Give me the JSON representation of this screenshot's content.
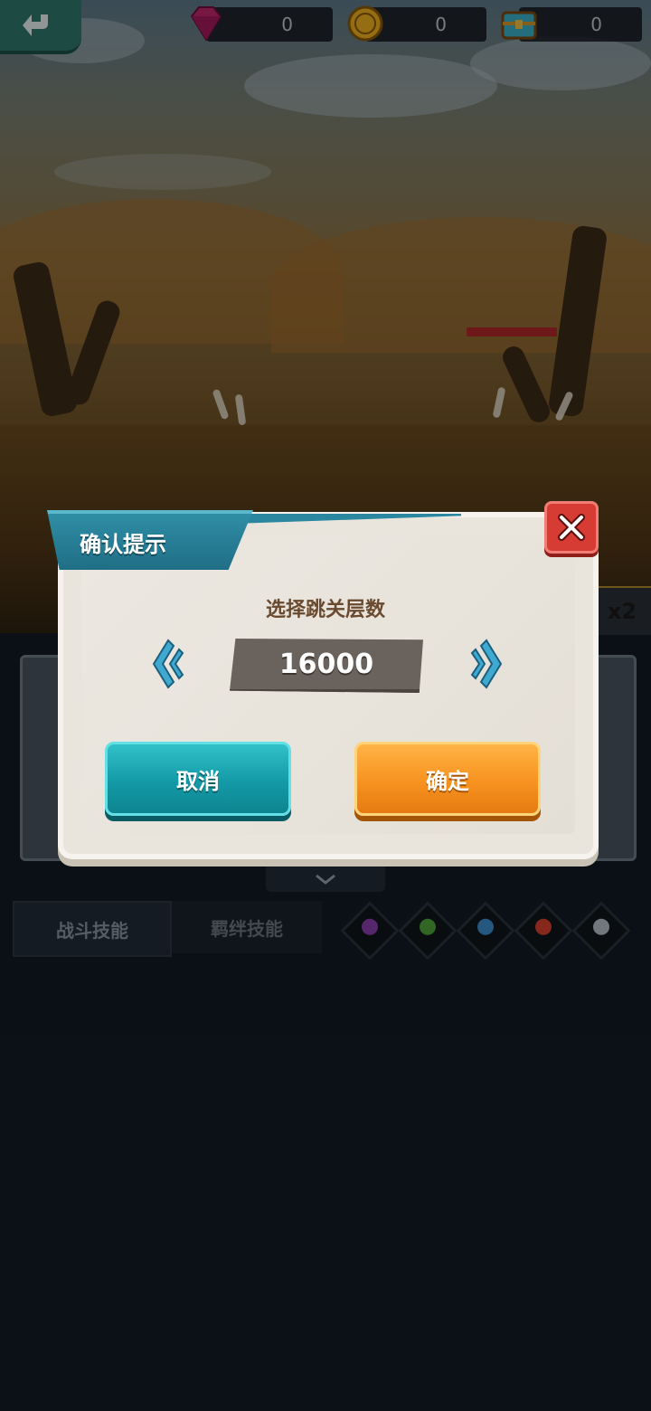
{
  "resources": [
    {
      "name": "gem",
      "value": "0",
      "icon": "gem-icon",
      "color": "#c2266e"
    },
    {
      "name": "coin",
      "value": "0",
      "icon": "coin-icon",
      "color": "#f0b020"
    },
    {
      "name": "chest",
      "value": "0",
      "icon": "treasure-chest-icon",
      "color": "#3ab0c8"
    }
  ],
  "speed_label": "x2",
  "tabs": [
    {
      "label": "战斗技能",
      "active": true
    },
    {
      "label": "羁绊技能",
      "active": false
    }
  ],
  "elements": [
    {
      "icon": "dark-element-icon",
      "color": "#8b3fb0"
    },
    {
      "icon": "wood-element-icon",
      "color": "#4fa53b"
    },
    {
      "icon": "water-element-icon",
      "color": "#3a8fd0"
    },
    {
      "icon": "fire-element-icon",
      "color": "#d9412d"
    },
    {
      "icon": "light-element-icon",
      "color": "#b8c0cc"
    }
  ],
  "dialog": {
    "title": "确认提示",
    "prompt": "选择跳关层数",
    "value": "16000",
    "cancel_label": "取消",
    "confirm_label": "确定"
  },
  "colors": {
    "cancel": "#139aa6",
    "confirm": "#f7921f",
    "close": "#d63b34",
    "title_ribbon": "#1f6e86"
  }
}
